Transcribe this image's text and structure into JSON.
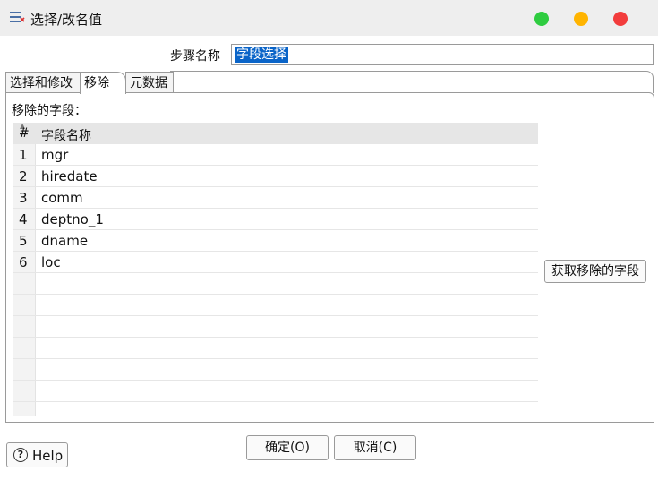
{
  "window": {
    "title": "选择/改名值",
    "controls": {
      "maximize_color": "#2ecc40",
      "minimize_color": "#ffb400",
      "close_color": "#f23c3c"
    }
  },
  "step": {
    "label": "步骤名称",
    "value": "字段选择",
    "selection_color": "#0a64c8"
  },
  "tabs": [
    {
      "label": "选择和修改",
      "active": false
    },
    {
      "label": "移除",
      "active": true
    },
    {
      "label": "元数据",
      "active": false
    }
  ],
  "remove_panel": {
    "fields_label": "移除的字段：",
    "table": {
      "headers": {
        "num": "#",
        "name": "字段名称"
      },
      "rows": [
        {
          "num": "1",
          "name": "mgr"
        },
        {
          "num": "2",
          "name": "hiredate"
        },
        {
          "num": "3",
          "name": "comm"
        },
        {
          "num": "4",
          "name": "deptno_1"
        },
        {
          "num": "5",
          "name": "dname"
        },
        {
          "num": "6",
          "name": "loc"
        }
      ]
    },
    "get_fields_button": "获取移除的字段"
  },
  "footer": {
    "ok_label": "确定(O)",
    "cancel_label": "取消(C)",
    "help_icon_glyph": "?",
    "help_label": "Help"
  }
}
